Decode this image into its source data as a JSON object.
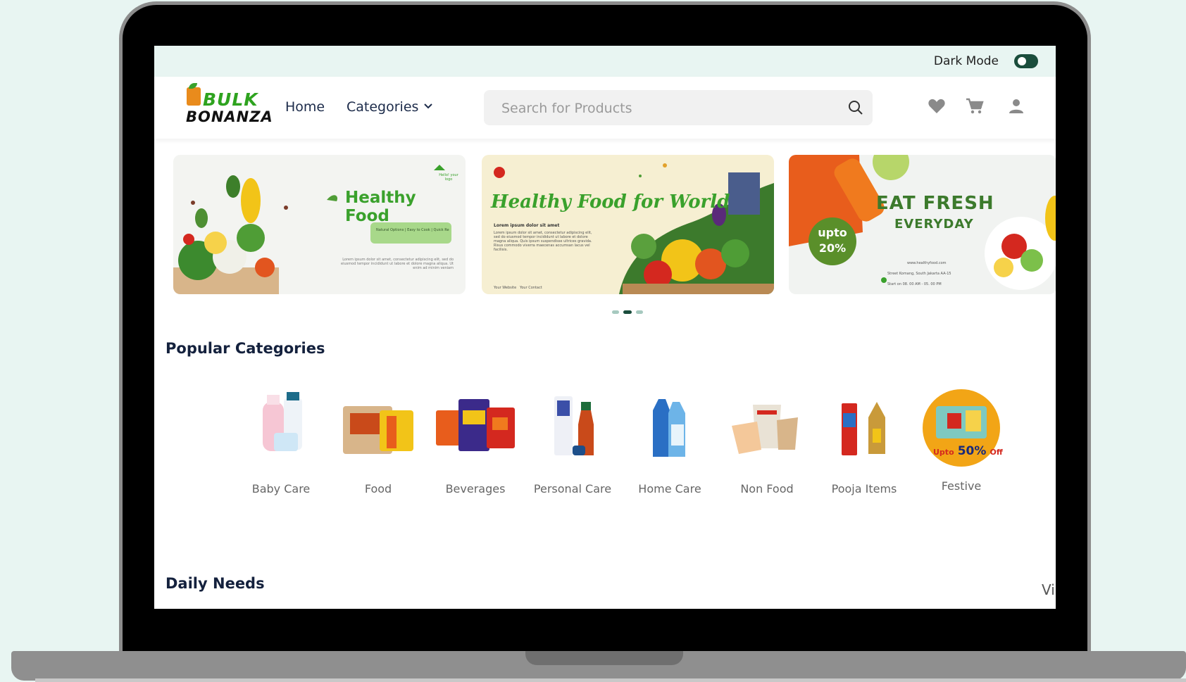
{
  "topbar": {
    "dark_mode_label": "Dark Mode",
    "dark_mode_on": true
  },
  "brand": {
    "line1": "BULK",
    "line2": "BONANZA"
  },
  "nav": {
    "home": "Home",
    "categories": "Categories"
  },
  "search": {
    "placeholder": "Search for Products"
  },
  "header_icons": [
    "heart-icon",
    "cart-icon",
    "user-icon"
  ],
  "banners": [
    {
      "title": "Healthy Food",
      "buttons": "Natural Options | Easy to Cook | Quick Recipes",
      "body": "Lorem ipsum dolor sit amet, consectetur adipiscing elit, sed do eiusmod tempor incididunt ut labore et dolore magna aliqua. Ut enim ad minim veniam",
      "badge": "Hello! your logo"
    },
    {
      "title": "Healthy Food for World",
      "subtitle": "Lorem ipsum dolor sit amet",
      "body": "Lorem ipsum dolor sit amet, consectetur adipiscing elit, sed do eiusmod tempor incididunt ut labore et dolore magna aliqua. Quis ipsum suspendisse ultrices gravida. Risus commodo viverra maecenas accumsan lacus vel facilisis.",
      "footer": "Your Website   Your Contact"
    },
    {
      "title": "EAT FRESH",
      "subtitle": "EVERYDAY",
      "badge_line1": "upto",
      "badge_line2": "20%",
      "info": [
        "www.healthyfood.com",
        "Street Komang, South Jakarta AA-15",
        "Start on 08. 00 AM - 05. 00 PM"
      ]
    }
  ],
  "carousel": {
    "count": 3,
    "active": 1
  },
  "popular": {
    "title": "Popular Categories",
    "items": [
      {
        "label": "Baby Care"
      },
      {
        "label": "Food"
      },
      {
        "label": "Beverages"
      },
      {
        "label": "Personal Care"
      },
      {
        "label": "Home Care"
      },
      {
        "label": "Non Food"
      },
      {
        "label": "Pooja Items"
      },
      {
        "label": "Festive",
        "badge_prefix": "Upto",
        "badge_value": "50%",
        "badge_suffix": "Off"
      }
    ]
  },
  "daily": {
    "title": "Daily Needs",
    "view_all": "Vi"
  },
  "colors": {
    "accent_green": "#2ea31f",
    "dark_green": "#1a4d3c",
    "mint": "#e8f5f2",
    "navy": "#14213d"
  }
}
